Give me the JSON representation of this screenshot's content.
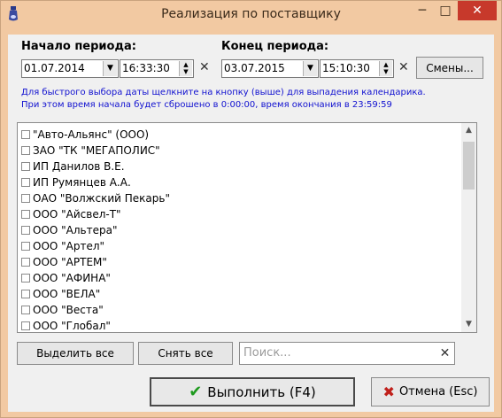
{
  "window": {
    "title": "Реализация по поставщику"
  },
  "period": {
    "start_label": "Начало периода:",
    "end_label": "Конец периода:",
    "start_date": "01.07.2014",
    "start_time": "16:33:30",
    "end_date": "03.07.2015",
    "end_time": "15:10:30",
    "clear_symbol": "✕",
    "shifts_button": "Смены..."
  },
  "hint": {
    "line1": "Для быстрого выбора даты щелкните на кнопку (выше) для выпадения календарика.",
    "line2": "При этом время начала будет сброшено в 0:00:00, время окончания в 23:59:59"
  },
  "suppliers": [
    "\"Авто-Альянс\" (ООО)",
    "ЗАО \"ТК \"МЕГАПОЛИС\"",
    "ИП Данилов В.Е.",
    "ИП Румянцев А.А.",
    "ОАО \"Волжский Пекарь\"",
    "ООО \"Айсвел-Т\"",
    "ООО \"Альтера\"",
    "ООО \"Артел\"",
    "ООО \"АРТЕМ\"",
    "ООО \"АФИНА\"",
    "ООО \"ВЕЛА\"",
    "ООО \"Веста\"",
    "ООО \"Глобал\""
  ],
  "actions": {
    "select_all": "Выделить все",
    "deselect_all": "Снять все",
    "search_placeholder": "Поиск...",
    "search_clear": "✕",
    "run": "Выполнить (F4)",
    "cancel": "Отмена (Esc)"
  },
  "colors": {
    "hint": "#1010d0",
    "close": "#c7392b",
    "frame": "#f2c9a2",
    "run_check": "#1e9a1e",
    "cancel_x": "#c0201b"
  }
}
